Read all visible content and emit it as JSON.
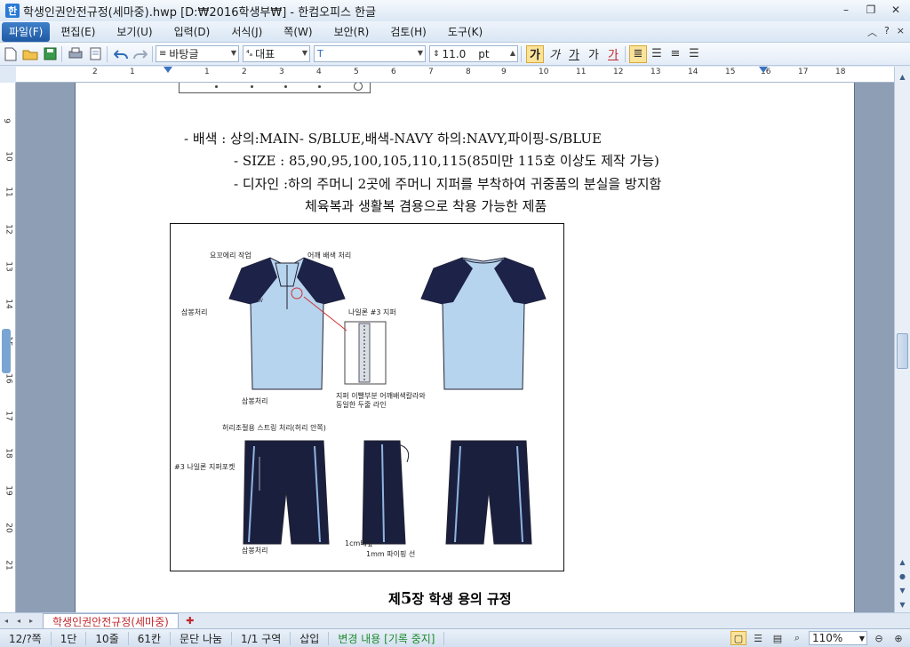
{
  "window": {
    "title": "학생인권안전규정(세마중).hwp [D:₩2016학생부₩] - 한컴오피스 한글",
    "minimize": "–",
    "restore": "❐",
    "close": "✕"
  },
  "menu": {
    "items": [
      "파일(F)",
      "편집(E)",
      "보기(U)",
      "입력(D)",
      "서식(J)",
      "쪽(W)",
      "보안(R)",
      "검토(H)",
      "도구(K)"
    ],
    "right_caret": "︿",
    "right_help": "?",
    "right_close": "×"
  },
  "toolbar": {
    "style_name": "바탕글",
    "font_lang": "대표",
    "font_name": "",
    "font_size": "11.0",
    "font_unit": "pt",
    "bold_label": "가",
    "italic_label": "가",
    "underline_label": "가",
    "strike_label": "가",
    "color_label": "가"
  },
  "ruler": {
    "h_numbers": [
      "2",
      "1",
      "1",
      "2",
      "3",
      "4",
      "5",
      "6",
      "7",
      "8",
      "9",
      "10",
      "11",
      "12",
      "13",
      "14",
      "15",
      "16",
      "17",
      "18"
    ],
    "v_numbers": [
      "9",
      "10",
      "11",
      "12",
      "13",
      "14",
      "15",
      "16",
      "17",
      "18",
      "19",
      "20",
      "21"
    ]
  },
  "document": {
    "line1": "- 배색 : 상의:MAIN- S/BLUE,배색-NAVY 하의:NAVY,파이핑-S/BLUE",
    "line2": "- SIZE : 85,90,95,100,105,110,115(85미만 115호 이상도 제작 가능)",
    "line3": "- 디자인 :하의 주머니 2곳에 주머니 지퍼를 부착하여 귀중품의 분실을 방지함",
    "line4": "체육복과 생활복 겸용으로 착용 가능한 제품",
    "chapter_prefix": "제",
    "chapter_number": "5",
    "chapter_rest": "장 학생 용의 규정",
    "figure_labels": {
      "collar": "요꼬에리 작업",
      "shoulder": "어깨 배색 처리",
      "sambong_top": "삼봉처리",
      "zipper": "나일론 #3 지퍼",
      "sambong_bottom": "삼봉처리",
      "zipper_note1": "지퍼 이빨부분 어깨배색칼라와",
      "zipper_note2": "동일한 두줄 라인",
      "waist": "허리조절용 스트링 처리(허리 안쪽)",
      "pocket": "#3 나일론 지퍼포켓",
      "pants_sambong": "삼봉처리",
      "tape": "1cm테잎",
      "piping": "1mm 파이핑 선"
    }
  },
  "tabs": {
    "doc_tab": "학생인권안전규정(세마중)"
  },
  "status": {
    "page": "12/?쪽",
    "column": "1단",
    "line": "10줄",
    "col": "61칸",
    "para": "문단 나눔",
    "section": "1/1 구역",
    "insert": "삽입",
    "track": "변경 내용 [기록 중지]",
    "zoom": "110%"
  }
}
